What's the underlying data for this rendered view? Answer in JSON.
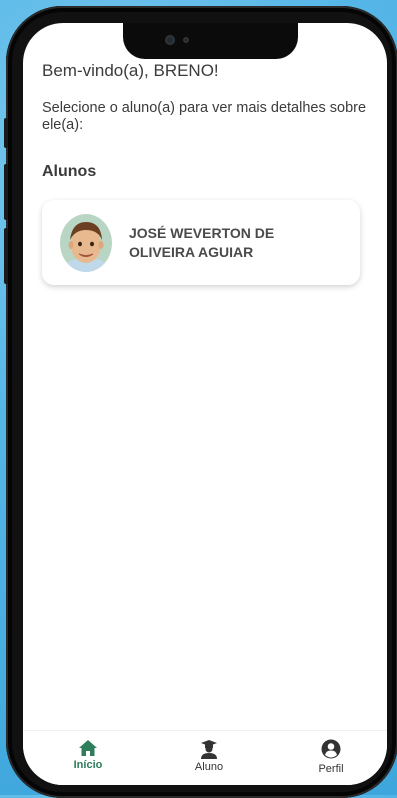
{
  "header": {
    "greeting": "Bem-vindo(a), BRENO!",
    "instruction": "Selecione o aluno(a) para ver mais detalhes sobre ele(a):"
  },
  "students_section": {
    "title": "Alunos",
    "students": [
      {
        "name": "JOSÉ WEVERTON DE OLIVEIRA AGUIAR"
      }
    ]
  },
  "nav": {
    "items": [
      {
        "label": "Início",
        "icon": "home-icon",
        "active": true
      },
      {
        "label": "Aluno",
        "icon": "student-icon",
        "active": false
      },
      {
        "label": "Perfil",
        "icon": "profile-icon",
        "active": false
      }
    ]
  },
  "colors": {
    "accent": "#2e7d5b",
    "background": "#55b6e6"
  }
}
